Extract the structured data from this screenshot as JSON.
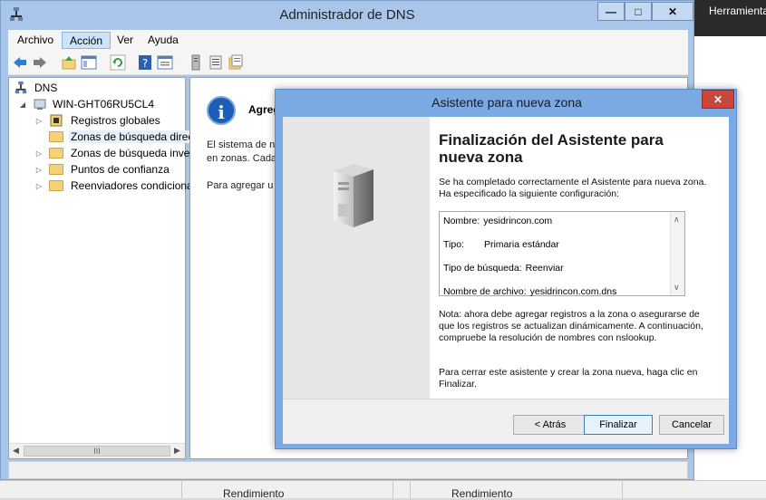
{
  "background": {
    "right_label": "Herramienta",
    "bottom_labels": [
      "Rendimiento",
      "Rendimiento"
    ]
  },
  "dns_window": {
    "title": "Administrador de DNS",
    "menu": [
      "Archivo",
      "Acción",
      "Ver",
      "Ayuda"
    ],
    "active_menu": "Acción",
    "tree": {
      "root": "DNS",
      "server": "WIN-GHT06RU5CL4",
      "children": [
        "Registros globales",
        "Zonas de búsqueda direc",
        "Zonas de búsqueda inver",
        "Puntos de confianza",
        "Reenviadores condiciona"
      ]
    },
    "content": {
      "heading": "Agreg",
      "line1": "El sistema de n",
      "line2": "en zonas. Cada",
      "line3": "Para agregar u"
    },
    "scroll_glyph": "III"
  },
  "wizard": {
    "title": "Asistente para nueva zona",
    "heading": "Finalización del Asistente para nueva zona",
    "intro": "Se ha completado correctamente el Asistente para nueva zona. Ha especificado la siguiente configuración:",
    "summary": [
      {
        "label": "Nombre:",
        "value": "yesidrincon.com"
      },
      {
        "label": "Tipo:",
        "value": "Primaria estándar"
      },
      {
        "label": "Tipo de búsqueda:",
        "value": "Reenviar"
      },
      {
        "label": "Nombre de archivo:",
        "value": "yesidrincon.com.dns"
      }
    ],
    "note": "Nota: ahora debe agregar registros a la zona o asegurarse de que los registros se actualizan dinámicamente. A continuación, compruebe la resolución de nombres con nslookup.",
    "close_hint": "Para cerrar este asistente y crear la zona nueva, haga clic en Finalizar.",
    "buttons": {
      "back": "< Atrás",
      "finish": "Finalizar",
      "cancel": "Cancelar"
    }
  }
}
